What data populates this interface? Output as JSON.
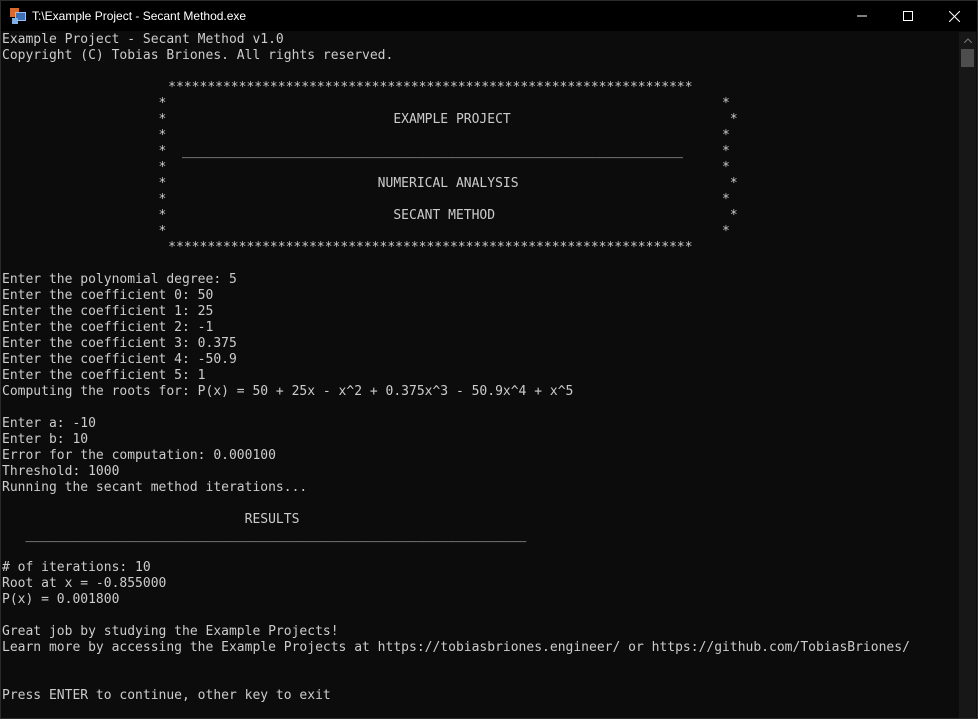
{
  "window": {
    "title": "T:\\Example Project - Secant Method.exe"
  },
  "console": {
    "header_line1": "Example Project - Secant Method v1.0",
    "header_line2": "Copyright (C) Tobias Briones. All rights reserved.",
    "banner_top": "                      *******************************************************************",
    "banner_blank1": "                    *                                                                       *",
    "banner_title": "                    *                             EXAMPLE PROJECT                            *",
    "banner_blank2": "                    *                                                                       *",
    "banner_rule": "                    *  ________________________________________________________________     *",
    "banner_blank3": "                    *                                                                       *",
    "banner_subtitle1": "                    *                           NUMERICAL ANALYSIS                           *",
    "banner_blank4": "                    *                                                                       *",
    "banner_subtitle2": "                    *                             SECANT METHOD                              *",
    "banner_blank5": "                    *                                                                       *",
    "banner_bottom": "                      *******************************************************************",
    "prompt_degree": "Enter the polynomial degree: 5",
    "coef0": "Enter the coefficient 0: 50",
    "coef1": "Enter the coefficient 1: 25",
    "coef2": "Enter the coefficient 2: -1",
    "coef3": "Enter the coefficient 3: 0.375",
    "coef4": "Enter the coefficient 4: -50.9",
    "coef5": "Enter the coefficient 5: 1",
    "computing": "Computing the roots for: P(x) = 50 + 25x - x^2 + 0.375x^3 - 50.9x^4 + x^5",
    "enter_a": "Enter a: -10",
    "enter_b": "Enter b: 10",
    "error": "Error for the computation: 0.000100",
    "threshold": "Threshold: 1000",
    "running": "Running the secant method iterations...",
    "results_title": "                               RESULTS",
    "results_rule": "   ________________________________________________________________",
    "iterations": "# of iterations: 10",
    "root": "Root at x = -0.855000",
    "px": "P(x) = 0.001800",
    "great_job": "Great job by studying the Example Projects!",
    "learn_more": "Learn more by accessing the Example Projects at https://tobiasbriones.engineer/ or https://github.com/TobiasBriones/",
    "press_enter": "Press ENTER to continue, other key to exit"
  },
  "colors": {
    "background": "#0c0c0c",
    "text": "#cccccc",
    "titlebar": "#000000"
  },
  "icons": {
    "app": "console-app-icon",
    "minimize": "minimize-icon",
    "maximize": "maximize-icon",
    "close": "close-icon"
  }
}
